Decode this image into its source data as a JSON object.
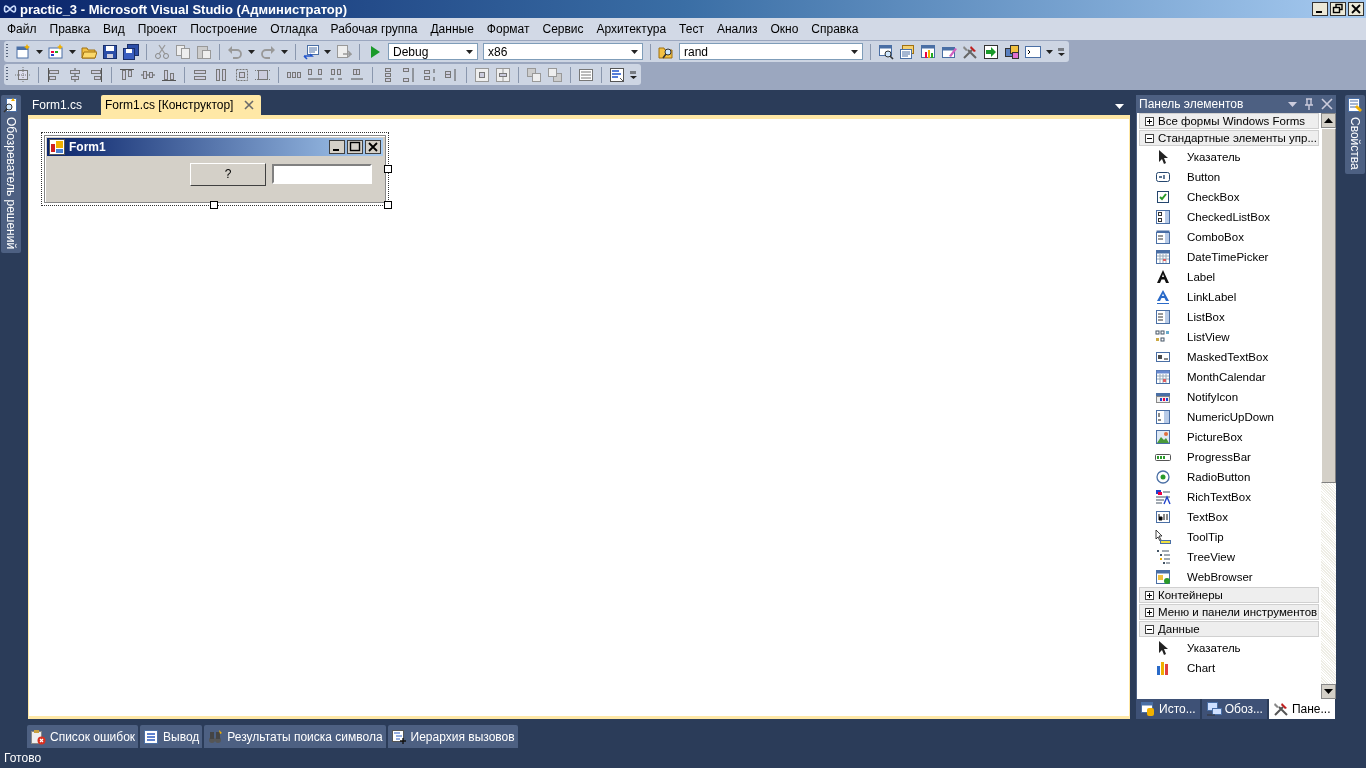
{
  "window": {
    "title": "practic_3 - Microsoft Visual Studio (Администратор)"
  },
  "menu": [
    {
      "label": "Файл"
    },
    {
      "label": "Правка"
    },
    {
      "label": "Вид"
    },
    {
      "label": "Проект"
    },
    {
      "label": "Построение"
    },
    {
      "label": "Отладка"
    },
    {
      "label": "Рабочая группа"
    },
    {
      "label": "Данные"
    },
    {
      "label": "Формат"
    },
    {
      "label": "Сервис"
    },
    {
      "label": "Архитектура"
    },
    {
      "label": "Тест"
    },
    {
      "label": "Анализ"
    },
    {
      "label": "Окно"
    },
    {
      "label": "Справка"
    }
  ],
  "standard_toolbar": {
    "configuration": "Debug",
    "platform": "x86",
    "find": "rand"
  },
  "left_side_tabs": [
    {
      "label": "Обозреватель решений"
    }
  ],
  "right_side_tabs": [
    {
      "label": "Свойства"
    }
  ],
  "document_tabs": [
    {
      "label": "Form1.cs",
      "selected": false
    },
    {
      "label": "Form1.cs [Конструктор]",
      "selected": true
    }
  ],
  "designer_form": {
    "title": "Form1",
    "button_label": "?"
  },
  "toolbox": {
    "title": "Панель элементов",
    "groups": [
      {
        "label": "Все формы Windows Forms",
        "expanded": false
      },
      {
        "label": "Стандартные элементы упр...",
        "expanded": true,
        "items": [
          {
            "label": "Указатель",
            "kind": "pointer"
          },
          {
            "label": "Button",
            "kind": "button"
          },
          {
            "label": "CheckBox",
            "kind": "checkbox"
          },
          {
            "label": "CheckedListBox",
            "kind": "checkedlistbox"
          },
          {
            "label": "ComboBox",
            "kind": "combobox"
          },
          {
            "label": "DateTimePicker",
            "kind": "datetimepicker"
          },
          {
            "label": "Label",
            "kind": "label"
          },
          {
            "label": "LinkLabel",
            "kind": "linklabel"
          },
          {
            "label": "ListBox",
            "kind": "listbox"
          },
          {
            "label": "ListView",
            "kind": "listview"
          },
          {
            "label": "MaskedTextBox",
            "kind": "maskedtextbox"
          },
          {
            "label": "MonthCalendar",
            "kind": "monthcalendar"
          },
          {
            "label": "NotifyIcon",
            "kind": "notifyicon"
          },
          {
            "label": "NumericUpDown",
            "kind": "numericupdown"
          },
          {
            "label": "PictureBox",
            "kind": "picturebox"
          },
          {
            "label": "ProgressBar",
            "kind": "progressbar"
          },
          {
            "label": "RadioButton",
            "kind": "radiobutton"
          },
          {
            "label": "RichTextBox",
            "kind": "richtextbox"
          },
          {
            "label": "TextBox",
            "kind": "textbox"
          },
          {
            "label": "ToolTip",
            "kind": "tooltip"
          },
          {
            "label": "TreeView",
            "kind": "treeview"
          },
          {
            "label": "WebBrowser",
            "kind": "webbrowser"
          }
        ]
      },
      {
        "label": "Контейнеры",
        "expanded": false
      },
      {
        "label": "Меню и панели инструментов",
        "expanded": false
      },
      {
        "label": "Данные",
        "expanded": true,
        "items": [
          {
            "label": "Указатель",
            "kind": "pointer"
          },
          {
            "label": "Chart",
            "kind": "chart"
          }
        ]
      }
    ],
    "tabs": [
      {
        "label": "Исто...",
        "kind": "datasource",
        "selected": false
      },
      {
        "label": "Обоз...",
        "kind": "server",
        "selected": false
      },
      {
        "label": "Пане...",
        "kind": "tools",
        "selected": true
      }
    ]
  },
  "bottom_tabs": [
    {
      "label": "Список ошибок",
      "kind": "errors"
    },
    {
      "label": "Вывод",
      "kind": "output"
    },
    {
      "label": "Результаты поиска символа",
      "kind": "symbols"
    },
    {
      "label": "Иерархия вызовов",
      "kind": "calls"
    }
  ],
  "status_bar": {
    "text": "Готово"
  }
}
